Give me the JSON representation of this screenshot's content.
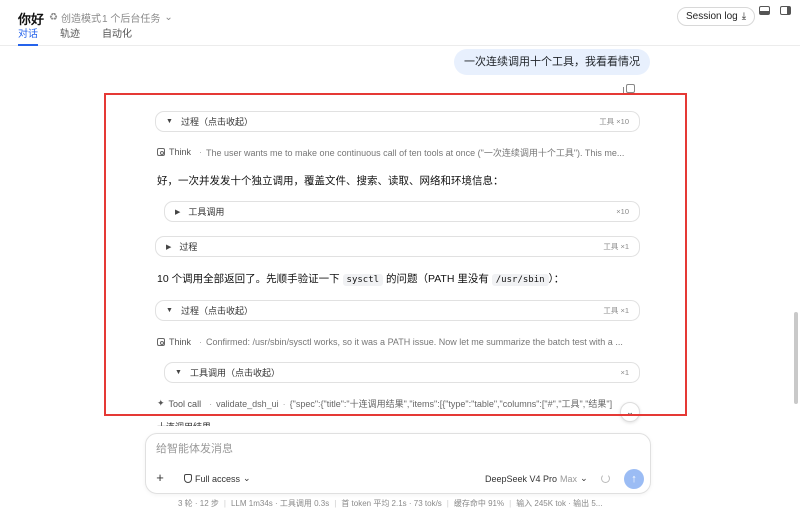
{
  "header": {
    "title": "你好",
    "mode_label": "创造模式",
    "tasks_label": "1 个后台任务",
    "tabs": [
      {
        "label": "对话",
        "active": true
      },
      {
        "label": "轨迹",
        "active": false
      },
      {
        "label": "自动化",
        "active": false
      }
    ],
    "session_log_label": "Session log"
  },
  "conversation": {
    "user_message": "一次连续调用十个工具，我看看情况",
    "process_1": {
      "label": "过程（点击收起）",
      "count": "工具 ×10"
    },
    "think_1": {
      "label": "Think",
      "text": "The user wants me to make one continuous call of ten tools at once (\"一次连续调用十个工具\"). This me..."
    },
    "para_1": "好，一次并发发十个独立调用，覆盖文件、搜索、读取、网络和环境信息：",
    "tool_group_1": {
      "label": "工具调用",
      "count": "×10"
    },
    "process_2": {
      "label": "过程",
      "count": "工具 ×1"
    },
    "para_2": {
      "before": "10 个调用全部返回了。先顺手验证一下",
      "code_1": "sysctl",
      "middle": "的问题（PATH 里没有",
      "code_2": "/usr/sbin",
      "after": "）："
    },
    "process_3": {
      "label": "过程（点击收起）",
      "count": "工具 ×1"
    },
    "think_2": {
      "label": "Think",
      "text": "Confirmed: /usr/sbin/sysctl works, so it was a PATH issue. Now let me summarize the batch test with a ..."
    },
    "tool_group_2": {
      "label": "工具调用（点击收起）",
      "count": "×1"
    },
    "tool_call": {
      "label": "Tool call",
      "name": "validate_dsh_ui",
      "args": "{\"spec\":{\"title\":\"十连调用结果\",\"items\":[{\"type\":\"table\",\"columns\":[\"#\",\"工具\",\"结果\"]"
    },
    "partial_text": "十连调用结果"
  },
  "composer": {
    "placeholder": "给智能体发消息",
    "access_label": "Full access",
    "model_name": "DeepSeek V4 Pro",
    "model_tier": "Max"
  },
  "status": {
    "rounds": "3 轮 · 12 步",
    "llm": "LLM 1m34s · 工具调用 0.3s",
    "token": "首 token 平均 2.1s · 73 tok/s",
    "cache": "缓存命中 91%",
    "io": "输入 245K tok · 输出 5..."
  },
  "colors": {
    "accent": "#2563eb",
    "highlight": "#e53935",
    "user_bubble": "#e8f0fd",
    "send": "#9bbcf4"
  }
}
